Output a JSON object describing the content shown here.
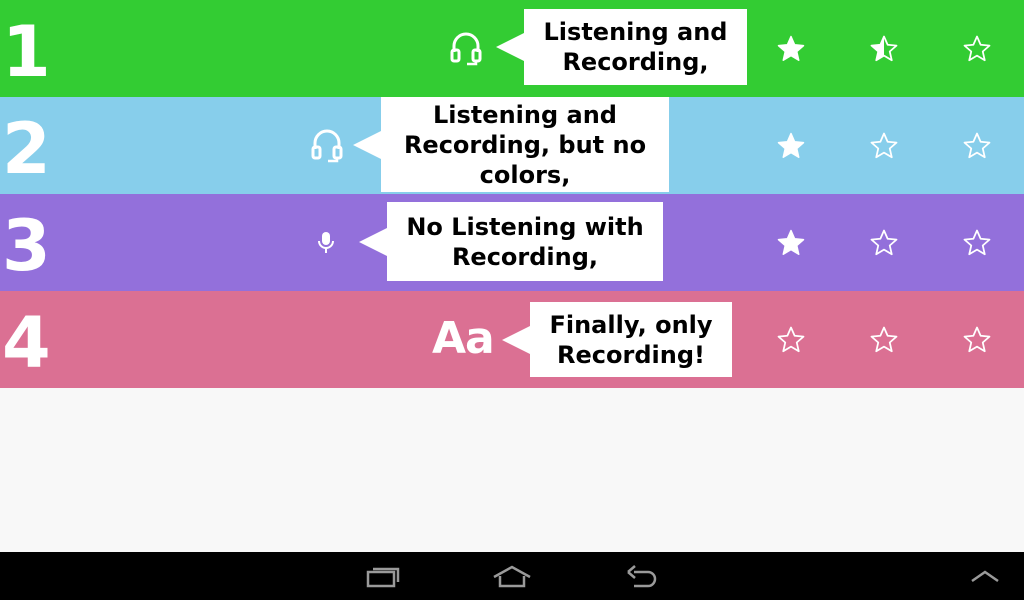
{
  "colors": {
    "row1": "#33cc33",
    "row2": "#87ceeb",
    "row3": "#9370db",
    "row4": "#db7093",
    "background": "#f8f8f8",
    "navbar": "#000000"
  },
  "rows": [
    {
      "number": "1",
      "icon": "headset-icon",
      "tip": "Listening and Recording,",
      "stars": [
        "full",
        "half",
        "empty"
      ]
    },
    {
      "number": "2",
      "icon": "headset-icon",
      "tip": "Listening and Recording, but no colors,",
      "stars": [
        "full",
        "empty",
        "empty"
      ]
    },
    {
      "number": "3",
      "icon": "microphone-icon",
      "tip": "No Listening with Recording,",
      "stars": [
        "full",
        "empty",
        "empty"
      ]
    },
    {
      "number": "4",
      "icon": "text-icon",
      "icon_text": "Aa",
      "tip": "Finally, only Recording!",
      "stars": [
        "empty",
        "empty",
        "empty"
      ]
    }
  ],
  "navbar": {
    "buttons": [
      "recent-apps-icon",
      "home-icon",
      "back-icon",
      "expand-up-icon"
    ]
  }
}
